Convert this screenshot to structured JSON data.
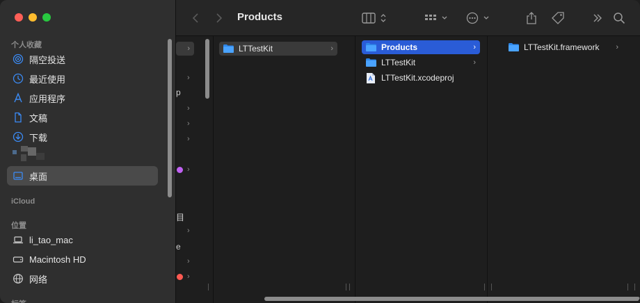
{
  "sidebar": {
    "favorites_title": "个人收藏",
    "favorites": [
      {
        "label": "隔空投送",
        "icon": "airdrop-icon"
      },
      {
        "label": "最近使用",
        "icon": "clock-icon"
      },
      {
        "label": "应用程序",
        "icon": "applications-icon"
      },
      {
        "label": "文稿",
        "icon": "document-icon"
      },
      {
        "label": "下载",
        "icon": "download-icon"
      },
      {
        "label": "桌面",
        "icon": "desktop-icon",
        "selected": true
      }
    ],
    "icloud_title": "iCloud",
    "locations_title": "位置",
    "locations": [
      {
        "label": "li_tao_mac",
        "icon": "laptop-icon"
      },
      {
        "label": "Macintosh HD",
        "icon": "disk-icon"
      },
      {
        "label": "网络",
        "icon": "network-icon"
      }
    ],
    "tags_title": "标签"
  },
  "toolbar": {
    "title": "Products",
    "icons": [
      "back-icon",
      "forward-icon",
      "column-view-icon",
      "group-icon",
      "action-icon",
      "share-icon",
      "tag-icon",
      "more-icon",
      "search-icon"
    ]
  },
  "columns": {
    "col2": [
      {
        "label": "LTTestKit",
        "type": "folder",
        "state": "selected-gray"
      }
    ],
    "col3": [
      {
        "label": "Products",
        "type": "folder",
        "state": "selected-blue"
      },
      {
        "label": "LTTestKit",
        "type": "folder",
        "state": "normal"
      },
      {
        "label": "LTTestKit.xcodeproj",
        "type": "xcodeproj",
        "state": "normal"
      }
    ],
    "col4": [
      {
        "label": "LTTestKit.framework",
        "type": "folder",
        "state": "normal"
      }
    ]
  },
  "colors": {
    "accent_blue": "#2a5cd7",
    "folder_blue": "#3b8bf5",
    "tag_purple": "#c061f2",
    "tag_red": "#ff5a52"
  }
}
